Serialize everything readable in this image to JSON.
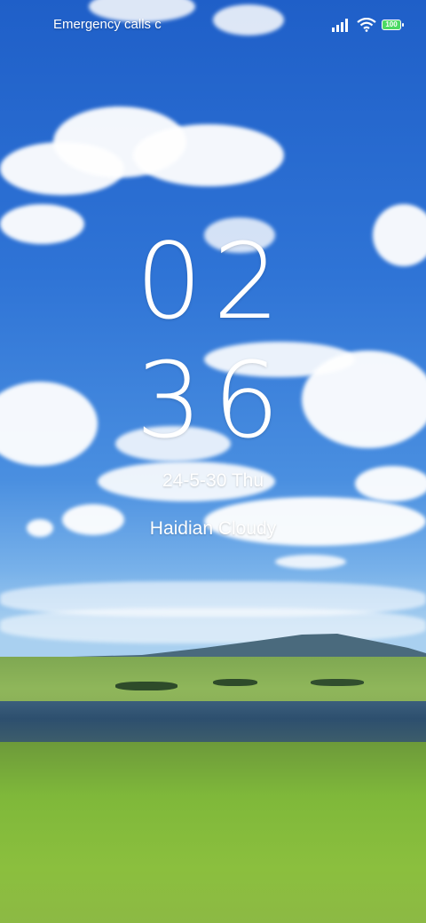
{
  "status_bar": {
    "left_text": "Emergency calls c",
    "battery_level": "100",
    "signal_icon": "cellular-signal-icon",
    "wifi_icon": "wifi-icon",
    "battery_icon": "battery-icon",
    "battery_color": "#4cd964"
  },
  "lock_screen": {
    "hours": "02",
    "minutes": "36",
    "date": "24-5-30 Thu",
    "weather": "Haidian Cloudy"
  },
  "colors": {
    "sky_top": "#1f5fc8",
    "grass": "#7fb83a",
    "text": "#ffffff"
  }
}
